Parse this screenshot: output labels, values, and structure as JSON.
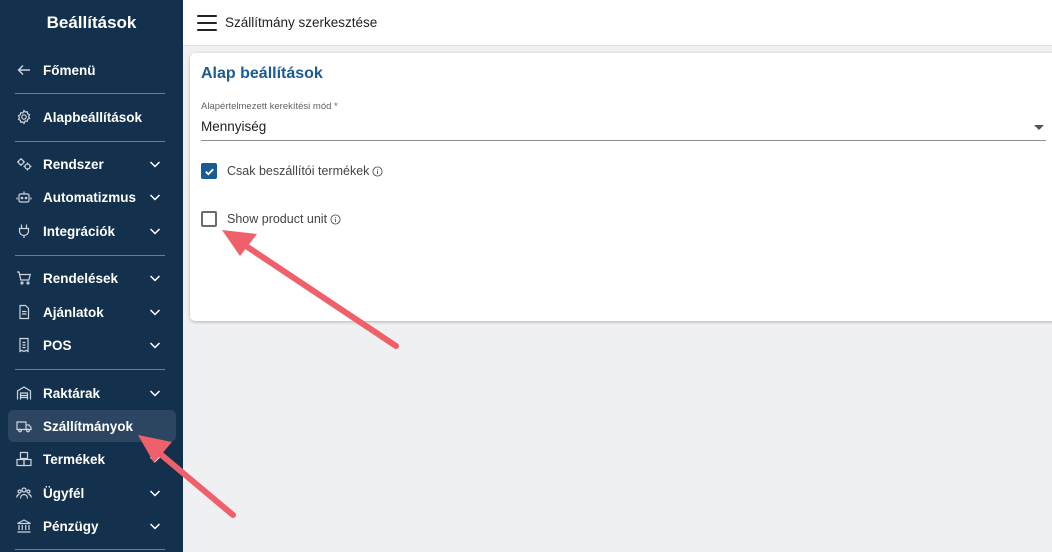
{
  "sidebar": {
    "title": "Beállítások",
    "items": [
      {
        "id": "fomenu",
        "label": "Főmenü",
        "icon": "arrow-left-icon",
        "chevron": false
      },
      {
        "id": "alap",
        "label": "Alapbeállítások",
        "icon": "settings-icon",
        "chevron": false
      },
      {
        "id": "rendszer",
        "label": "Rendszer",
        "icon": "gears-icon",
        "chevron": true
      },
      {
        "id": "automatizmus",
        "label": "Automatizmus",
        "icon": "robot-icon",
        "chevron": true
      },
      {
        "id": "integraciok",
        "label": "Integrációk",
        "icon": "plug-icon",
        "chevron": true
      },
      {
        "id": "rendelesek",
        "label": "Rendelések",
        "icon": "cart-icon",
        "chevron": true
      },
      {
        "id": "ajanlatok",
        "label": "Ajánlatok",
        "icon": "document-icon",
        "chevron": true
      },
      {
        "id": "pos",
        "label": "POS",
        "icon": "receipt-icon",
        "chevron": true
      },
      {
        "id": "raktarak",
        "label": "Raktárak",
        "icon": "warehouse-icon",
        "chevron": true
      },
      {
        "id": "szallitmanyok",
        "label": "Szállítmányok",
        "icon": "truck-icon",
        "chevron": false,
        "active": true
      },
      {
        "id": "termekek",
        "label": "Termékek",
        "icon": "boxes-icon",
        "chevron": true
      },
      {
        "id": "ugyfel",
        "label": "Ügyfél",
        "icon": "users-icon",
        "chevron": true
      },
      {
        "id": "penzugy",
        "label": "Pénzügy",
        "icon": "bank-icon",
        "chevron": true
      }
    ]
  },
  "header": {
    "title": "Szállítmány szerkesztése"
  },
  "card": {
    "title": "Alap beállítások",
    "rounding": {
      "label": "Alapértelmezett kerekítési mód *",
      "value": "Mennyiség"
    },
    "supplier_only": {
      "label": "Csak beszállítói termékek",
      "checked": true
    },
    "show_unit": {
      "label": "Show product unit",
      "checked": false
    }
  },
  "colors": {
    "sidebar_bg": "#13304c",
    "active_item_bg": "#2c4661",
    "accent": "#1a5b93",
    "arrow": "#f0606a"
  }
}
